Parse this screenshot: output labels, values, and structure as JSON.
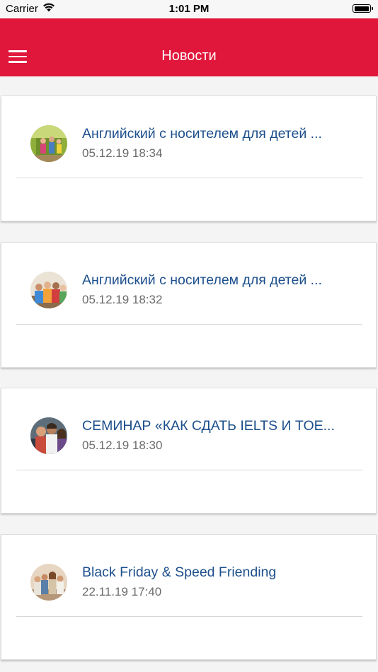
{
  "status_bar": {
    "carrier": "Carrier",
    "time": "1:01 PM",
    "battery_level": 1.0
  },
  "header": {
    "title": "Новости",
    "background_color": "#e0173b",
    "menu_icon": "hamburger-menu-icon"
  },
  "news": [
    {
      "title": "Английский с носителем для детей ...",
      "date": "05.12.19 18:34"
    },
    {
      "title": "Английский с носителем для детей ...",
      "date": "05.12.19 18:32"
    },
    {
      "title": "СЕМИНАР «КАК СДАТЬ IELTS И TOE...",
      "date": "05.12.19 18:30"
    },
    {
      "title": "Black Friday & Speed Friending",
      "date": "22.11.19 17:40"
    }
  ],
  "colors": {
    "title_link": "#1c4f8c",
    "date_text": "#6b6b6b"
  }
}
